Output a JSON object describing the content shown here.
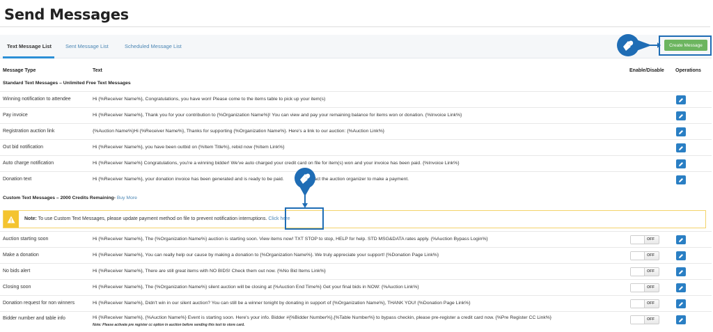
{
  "page": {
    "title": "Send Messages"
  },
  "tabs": [
    {
      "label": "Text Message List",
      "active": true
    },
    {
      "label": "Sent Message List",
      "active": false
    },
    {
      "label": "Scheduled Message List",
      "active": false
    }
  ],
  "create_button": {
    "label": "Create Message",
    "color": "#6cb55f"
  },
  "columns": {
    "type": "Message Type",
    "text": "Text",
    "enable": "Enable/Disable",
    "ops": "Operations"
  },
  "standard_section": {
    "title": "Standard Text Messages – Unlimited Free Text Messages"
  },
  "standard_rows": [
    {
      "type": "Winning notification to attendee",
      "text": "Hi {%Receiver Name%}, Congratulations, you have won! Please come to the items table to pick up your item(s)"
    },
    {
      "type": "Pay invoice",
      "text": "Hi {%Receiver Name%}, Thank you for your contribution to {%Organization Name%}! You can view and pay your remaining balance for items won or donation. {%Invoice Link%}"
    },
    {
      "type": "Registration auction link",
      "text": "{%Auction Name%}Hi {%Receiver Name%}, Thanks for supporting {%Organization Name%}. Here's a link to our auction: {%Auction Link%}"
    },
    {
      "type": "Out bid notification",
      "text": "Hi {%Receiver Name%}, you have been outbid on {%Item Title%}, rebid now {%Item Link%}"
    },
    {
      "type": "Auto charge notification",
      "text": "Hi {%Receiver Name%} Congratulations, you're a winning bidder! We've auto charged your credit card on file for item(s) won and your invoice has been paid. {%Invoice Link%}"
    },
    {
      "type": "Donation text",
      "text": "Hi {%Receiver Name%}, your donation invoice has been generated and is ready to be paid.                    ntact the auction organizer to make a payment."
    }
  ],
  "custom_section": {
    "title": "Custom Text Messages – 2000 Credits Remaining-",
    "buy_more": "Buy More"
  },
  "alert": {
    "label": "Note:",
    "message": "To use Custom Text Messages, please update payment method on file to prevent notification interruptions.",
    "link": "Click here"
  },
  "custom_rows": [
    {
      "type": "Auction starting soon",
      "text": "Hi {%Receiver Name%}, The {%Organization Name%} auction is starting soon. View items now! TXT STOP to stop, HELP for help. STD MSG&DATA rates apply. {%Auction Bypass Login%}",
      "toggle": "OFF"
    },
    {
      "type": "Make a donation",
      "text": "Hi {%Receiver Name%}, You can really help our cause by making a donation to {%Organization Name%}. We truly appreciate your support! {%Donation Page Link%}",
      "toggle": "OFF"
    },
    {
      "type": "No bids alert",
      "text": "Hi {%Receiver Name%}, There are still great items with NO BIDS! Check them out now. {%No Bid Items Link%}",
      "toggle": "OFF"
    },
    {
      "type": "Closing soon",
      "text": "Hi {%Receiver Name%}, The {%Organization Name%} silent auction will be closing at {%Auction End Time%} Get your final bids in NOW: {%Auction Link%}",
      "toggle": "OFF"
    },
    {
      "type": "Donation request for non winners",
      "text": "Hi {%Receiver Name%}, Didn't win in our silent auction? You can still be a winner tonight by donating in support of {%Organization Name%}, THANK YOU! {%Donation Page Link%}",
      "toggle": "OFF"
    },
    {
      "type": "Bidder number and table info",
      "text": "Hi {%Receiver Name%}, {%Auction Name%} Event is starting soon. Here's your info. Bidder #{%Bidder Number%},{%Table Number%} to bypass checkin, please pre-register a credit card now. {%Pre Register CC Link%}",
      "note": "Note: Please activate pre register cc option in auction before sending this text to store card.",
      "toggle": "OFF"
    }
  ],
  "icons": {
    "edit": "pencil-icon",
    "warning": "warning-icon",
    "marker": "map-pin-hand-icon"
  },
  "colors": {
    "accent": "#2a7fc4",
    "marker": "#1f6db5",
    "warning": "#f4c430"
  }
}
